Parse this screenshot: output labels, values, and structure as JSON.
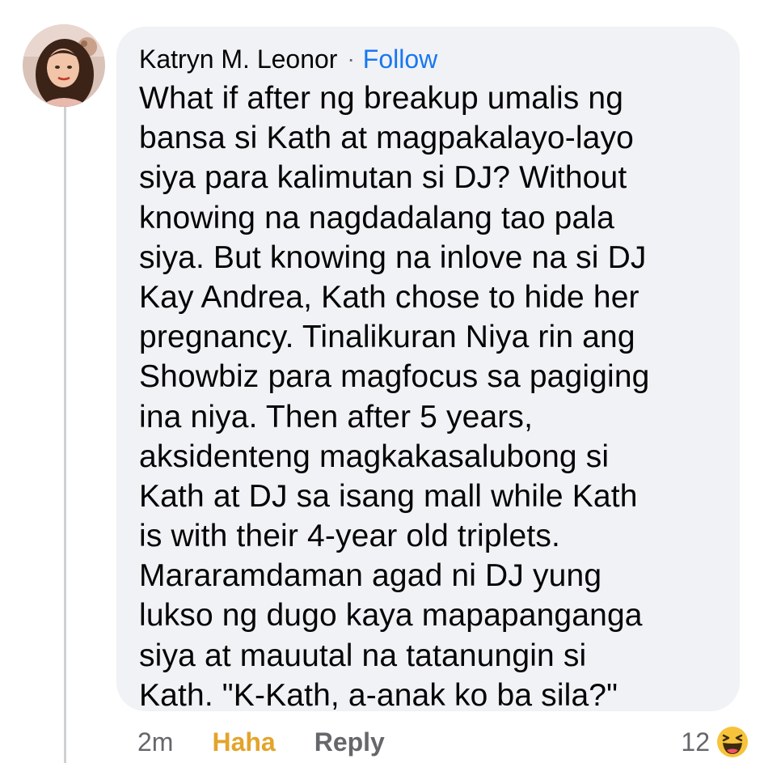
{
  "comment": {
    "author": "Katryn M. Leonor",
    "separator": "·",
    "follow_label": "Follow",
    "lines": [
      "What if after ng breakup umalis ng",
      "bansa si Kath at magpakalayo-layo",
      "siya para kalimutan si DJ? Without",
      "knowing na nagdadalang tao pala",
      "siya. But knowing na inlove na si DJ",
      "Kay Andrea, Kath chose to hide her",
      "pregnancy. Tinalikuran Niya rin ang",
      "Showbiz para magfocus sa pagiging",
      "ina niya. Then after 5 years,",
      "aksidenteng magkakasalubong si",
      "Kath at DJ sa isang mall while Kath",
      "is with their 4-year old triplets.",
      "Mararamdaman agad ni DJ yung",
      "lukso ng dugo kaya mapapanganga",
      "siya at mauutal na tatanungin si",
      "Kath. \"K-Kath, a-anak ko ba sila?\""
    ]
  },
  "actions": {
    "time": "2m",
    "reaction_label": "Haha",
    "reply_label": "Reply"
  },
  "reactions": {
    "count": "12",
    "icon": "haha-emoji-icon"
  },
  "colors": {
    "bubble_bg": "#f0f2f5",
    "text": "#050505",
    "secondary_text": "#65676b",
    "link": "#1877f2",
    "haha": "#e3a42b",
    "thread_line": "#ced0d4"
  }
}
